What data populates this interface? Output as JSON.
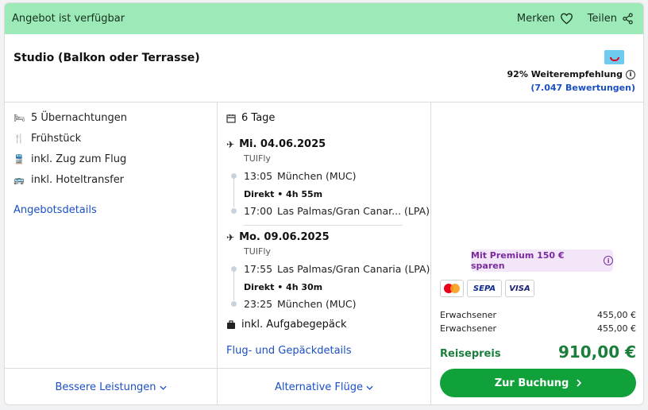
{
  "banner": {
    "availability": "Angebot ist verfügbar",
    "save_label": "Merken",
    "share_label": "Teilen"
  },
  "offer": {
    "room": "Studio (Balkon oder Terrasse)",
    "recommendation": "92% Weiterempfehlung",
    "reviews": "(7.047 Bewertungen)"
  },
  "features": {
    "items": [
      {
        "icon": "bed-icon",
        "label": "5 Übernachtungen"
      },
      {
        "icon": "cutlery-icon",
        "label": "Frühstück"
      },
      {
        "icon": "train-icon",
        "label": "inkl. Zug zum Flug"
      },
      {
        "icon": "bus-icon",
        "label": "inkl. Hoteltransfer"
      }
    ],
    "details_link": "Angebotsdetails",
    "footer_link": "Bessere Leistungen"
  },
  "flights": {
    "duration_days": "6 Tage",
    "outbound": {
      "date": "Mi. 04.06.2025",
      "airline": "TUIFly",
      "dep_time": "13:05",
      "dep_place": "München (MUC)",
      "info": "Direkt • 4h 55m",
      "arr_time": "17:00",
      "arr_place": "Las Palmas/Gran Canar... (LPA)"
    },
    "inbound": {
      "date": "Mo. 09.06.2025",
      "airline": "TUIFly",
      "dep_time": "17:55",
      "dep_place": "Las Palmas/Gran Canaria (LPA)",
      "info": "Direkt • 4h 30m",
      "arr_time": "23:25",
      "arr_place": "München (MUC)"
    },
    "baggage": "inkl. Aufgabegepäck",
    "details_link": "Flug- und Gepäckdetails",
    "footer_link": "Alternative Flüge"
  },
  "pricing": {
    "premium": "Mit Premium 150 € sparen",
    "payment_methods": {
      "sepa": "SEPA",
      "visa": "VISA"
    },
    "rows": [
      {
        "label": "Erwachsener",
        "price": "455,00 €"
      },
      {
        "label": "Erwachsener",
        "price": "455,00 €"
      }
    ],
    "total_label": "Reisepreis",
    "total_value": "910,00 €",
    "book_label": "Zur Buchung"
  },
  "colors": {
    "banner": "#9ceab7",
    "link": "#1b4fc4",
    "price_green": "#1b7e3b",
    "button_green": "#10a13a",
    "premium_bg": "#f2e6f8"
  }
}
